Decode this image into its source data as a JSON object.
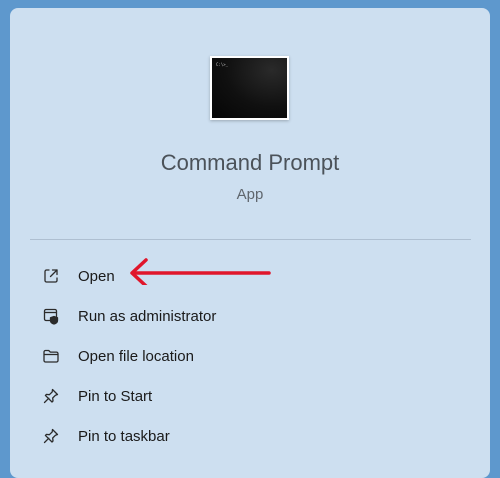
{
  "app": {
    "name": "Command Prompt",
    "type": "App",
    "icon": "command-prompt-icon",
    "icon_prompt": "C:\\>_"
  },
  "menu": {
    "items": [
      {
        "label": "Open",
        "icon": "open-external-icon"
      },
      {
        "label": "Run as administrator",
        "icon": "run-as-admin-icon"
      },
      {
        "label": "Open file location",
        "icon": "folder-icon"
      },
      {
        "label": "Pin to Start",
        "icon": "pin-icon"
      },
      {
        "label": "Pin to taskbar",
        "icon": "pin-icon"
      }
    ]
  },
  "colors": {
    "background": "#5e98cd",
    "panel": "#cddff0",
    "arrow": "#e0162b"
  }
}
